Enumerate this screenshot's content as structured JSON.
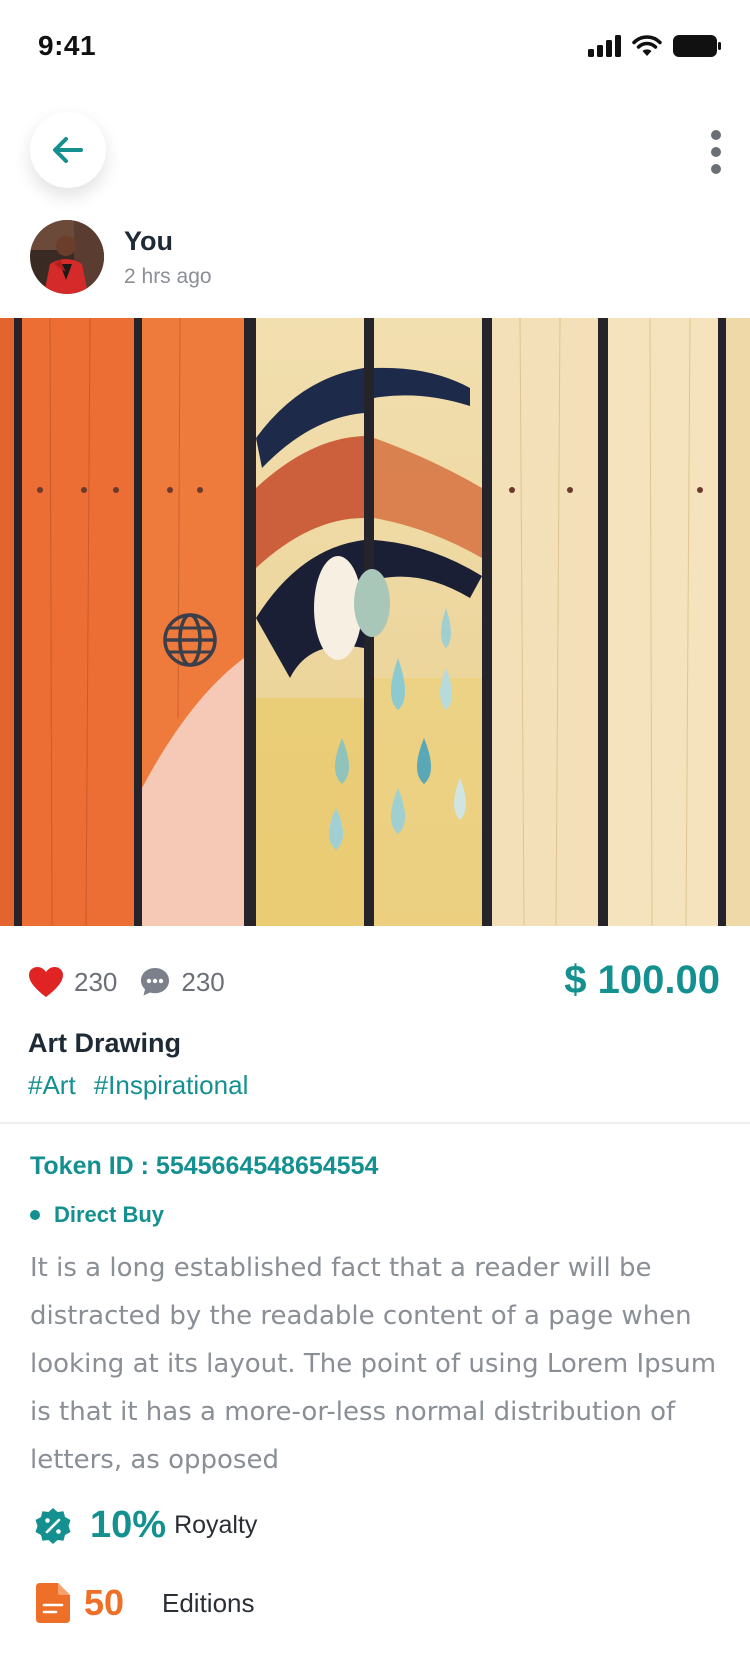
{
  "status": {
    "time": "9:41"
  },
  "post": {
    "author_name": "You",
    "time_ago": "2 hrs ago",
    "likes": "230",
    "comments": "230",
    "price": "$ 100.00",
    "title": "Art Drawing",
    "tags": [
      "#Art",
      "#Inspirational"
    ],
    "token_id": "Token ID : 5545664548654554",
    "buy_type": "Direct Buy",
    "description": "It is a long established fact that a reader will be distracted by the readable content of a page when looking at its layout. The point of using Lorem Ipsum is that it has a more-or-less normal distribution of letters, as opposed",
    "royalty_value": "10%",
    "royalty_label": "Royalty",
    "editions_value": "50",
    "editions_label": "Editions"
  },
  "icons": {
    "back": "arrow-left-icon",
    "more": "more-vertical-icon",
    "like": "heart-icon",
    "comment": "chat-bubble-icon",
    "royalty": "percent-badge-icon",
    "editions": "document-icon",
    "globe": "globe-icon"
  },
  "colors": {
    "accent": "#13908f",
    "heart": "#e02424",
    "editions": "#ee6f28"
  }
}
